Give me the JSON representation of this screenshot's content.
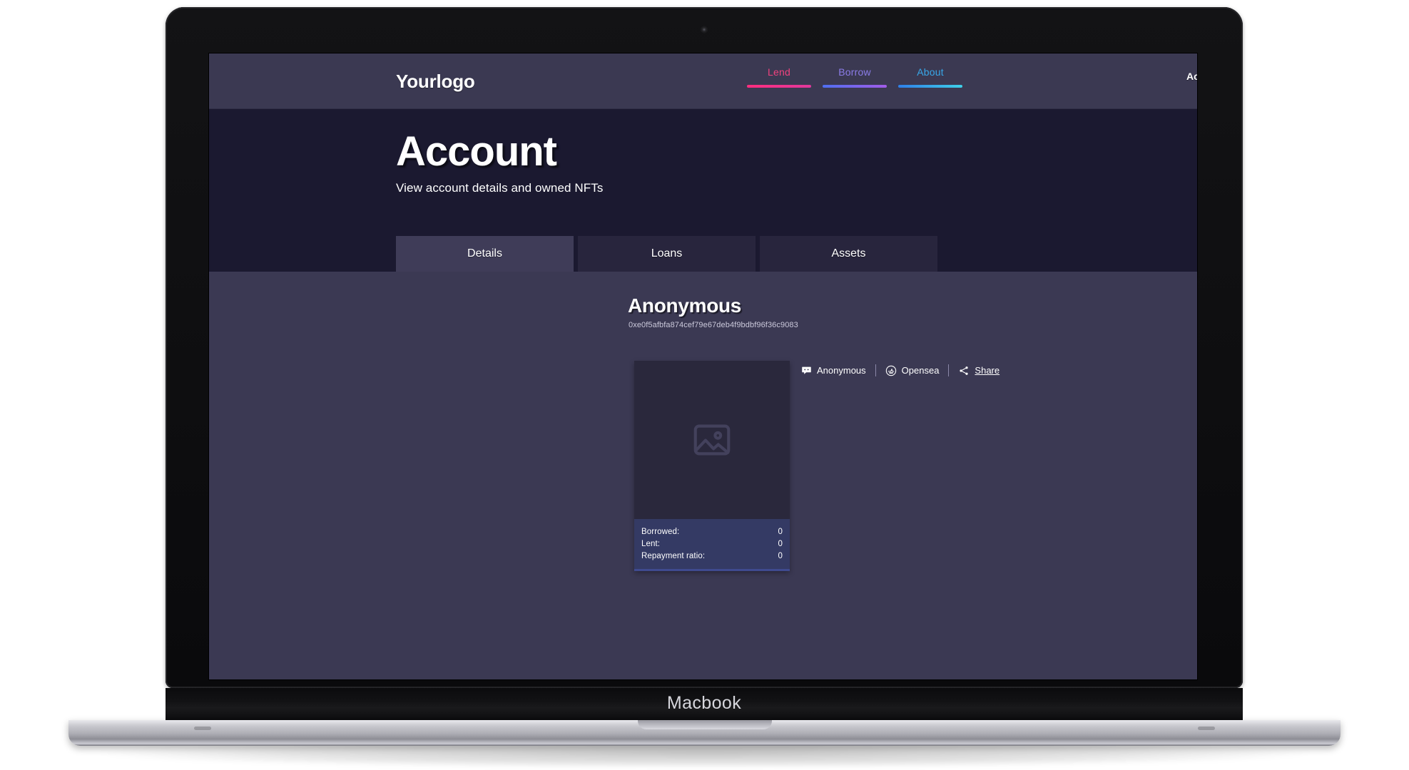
{
  "device": {
    "label": "Macbook",
    "camera_icon": "camera-dot"
  },
  "navbar": {
    "brand": "Yourlogo",
    "links": [
      {
        "label": "Lend",
        "color": "#f0427e",
        "bar_from": "#ff2d7e",
        "bar_to": "#e0399c"
      },
      {
        "label": "Borrow",
        "color": "#8b7ce8",
        "bar_from": "#4f6ff0",
        "bar_to": "#a25ce8"
      },
      {
        "label": "About",
        "color": "#38a7e8",
        "bar_from": "#2f7fe8",
        "bar_to": "#3fd0e8"
      }
    ],
    "account_label": "Account",
    "bell_icon": "bell-icon"
  },
  "hero": {
    "title": "Account",
    "subtitle": "View account details and owned NFTs",
    "background": "#1b1930"
  },
  "tabs": [
    {
      "label": "Details",
      "active": true
    },
    {
      "label": "Loans",
      "active": false
    },
    {
      "label": "Assets",
      "active": false
    }
  ],
  "account": {
    "name": "Anonymous",
    "address": "0xe0f5afbfa874cef79e67deb4f9bdbf96f36c9083"
  },
  "nft_card": {
    "placeholder_icon": "image-placeholder-icon",
    "stats": [
      {
        "label": "Borrowed:",
        "value": "0"
      },
      {
        "label": "Lent:",
        "value": "0"
      },
      {
        "label": "Repayment ratio:",
        "value": "0"
      }
    ]
  },
  "links": [
    {
      "label": "Anonymous",
      "icon": "chat-bubble-icon",
      "underline": false
    },
    {
      "label": "Opensea",
      "icon": "opensea-icon",
      "underline": false
    },
    {
      "label": "Share",
      "icon": "share-nodes-icon",
      "underline": true
    }
  ],
  "colors": {
    "page_bg": "#3b3953",
    "navbar_bg": "#3b3952",
    "hero_bg": "#1b1930",
    "tab_inactive": "#28253d",
    "tab_active": "#3f3c58",
    "card_bg": "#4a4868",
    "card_image_bg": "#2a283c",
    "stats_bg": "#343a64",
    "stats_accent": "#3f4a8f"
  }
}
